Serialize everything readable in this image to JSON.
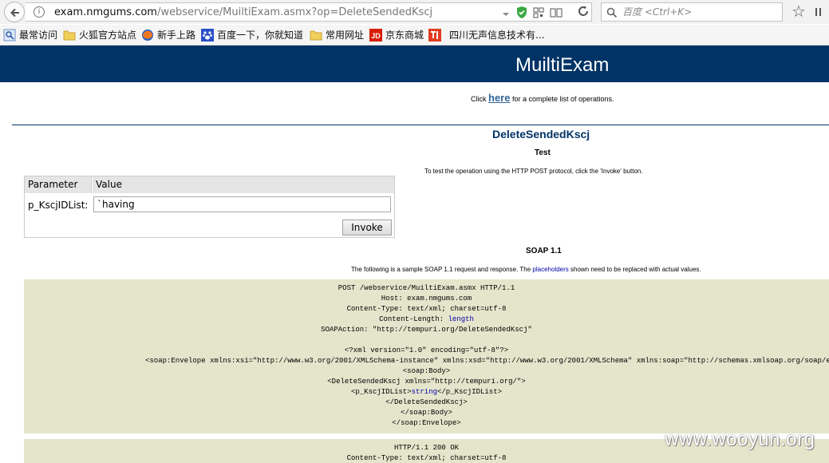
{
  "browser": {
    "url_host": "exam.nmgums.com",
    "url_path": "/webservice/MuiltiExam.asmx?op=DeleteSendedKscj",
    "search_placeholder": "百度 <Ctrl+K>"
  },
  "bookmarks": [
    {
      "label": "最常访问",
      "icon": "bookmark-star-icon"
    },
    {
      "label": "火狐官方站点",
      "icon": "folder-icon"
    },
    {
      "label": "新手上路",
      "icon": "firefox-icon"
    },
    {
      "label": "百度一下，你就知道",
      "icon": "baidu-paw-icon"
    },
    {
      "label": "常用网址",
      "icon": "folder-icon"
    },
    {
      "label": "京东商城",
      "icon": "jd-icon"
    },
    {
      "label": "四川无声信息技术有...",
      "icon": "sichuan-wusheng-icon"
    }
  ],
  "page": {
    "title": "MuiltiExam",
    "click_prefix": "Click ",
    "here_link": "here",
    "click_suffix": " for a complete list of operations.",
    "operation": "DeleteSendedKscj",
    "test_heading": "Test",
    "test_desc": "To test the operation using the HTTP POST protocol, click the 'Invoke' button.",
    "table": {
      "col_parameter": "Parameter",
      "col_value": "Value",
      "param_name": "p_KscjIDList:",
      "param_value": "`having",
      "invoke_label": "Invoke"
    },
    "soap_heading": "SOAP 1.1",
    "soap_desc_prefix": "The following is a sample SOAP 1.1 request and response.  The ",
    "soap_desc_link": "placeholders",
    "soap_desc_suffix": " shown need to be replaced with actual values."
  },
  "request_lines": {
    "l1": "POST /webservice/MuiltiExam.asmx HTTP/1.1",
    "l2": "Host: exam.nmgums.com",
    "l3": "Content-Type: text/xml; charset=utf-8",
    "l4_pre": "Content-Length: ",
    "l4_ph": "length",
    "l5": "SOAPAction: \"http://tempuri.org/DeleteSendedKscj\"",
    "l6": "<?xml version=\"1.0\" encoding=\"utf-8\"?>",
    "l7": "<soap:Envelope xmlns:xsi=\"http://www.w3.org/2001/XMLSchema-instance\" xmlns:xsd=\"http://www.w3.org/2001/XMLSchema\" xmlns:soap=\"http://schemas.xmlsoap.org/soap/envelope/\">",
    "l8": "<soap:Body>",
    "l9": "<DeleteSendedKscj xmlns=\"http://tempuri.org/\">",
    "l10_pre": "<p_KscjIDList>",
    "l10_ph": "string",
    "l10_post": "</p_KscjIDList>",
    "l11": "</DeleteSendedKscj>",
    "l12": "</soap:Body>",
    "l13": "</soap:Envelope>"
  },
  "response_lines": {
    "l1": "HTTP/1.1 200 OK",
    "l2": "Content-Type: text/xml; charset=utf-8"
  },
  "watermark": "www.wooyun.org"
}
